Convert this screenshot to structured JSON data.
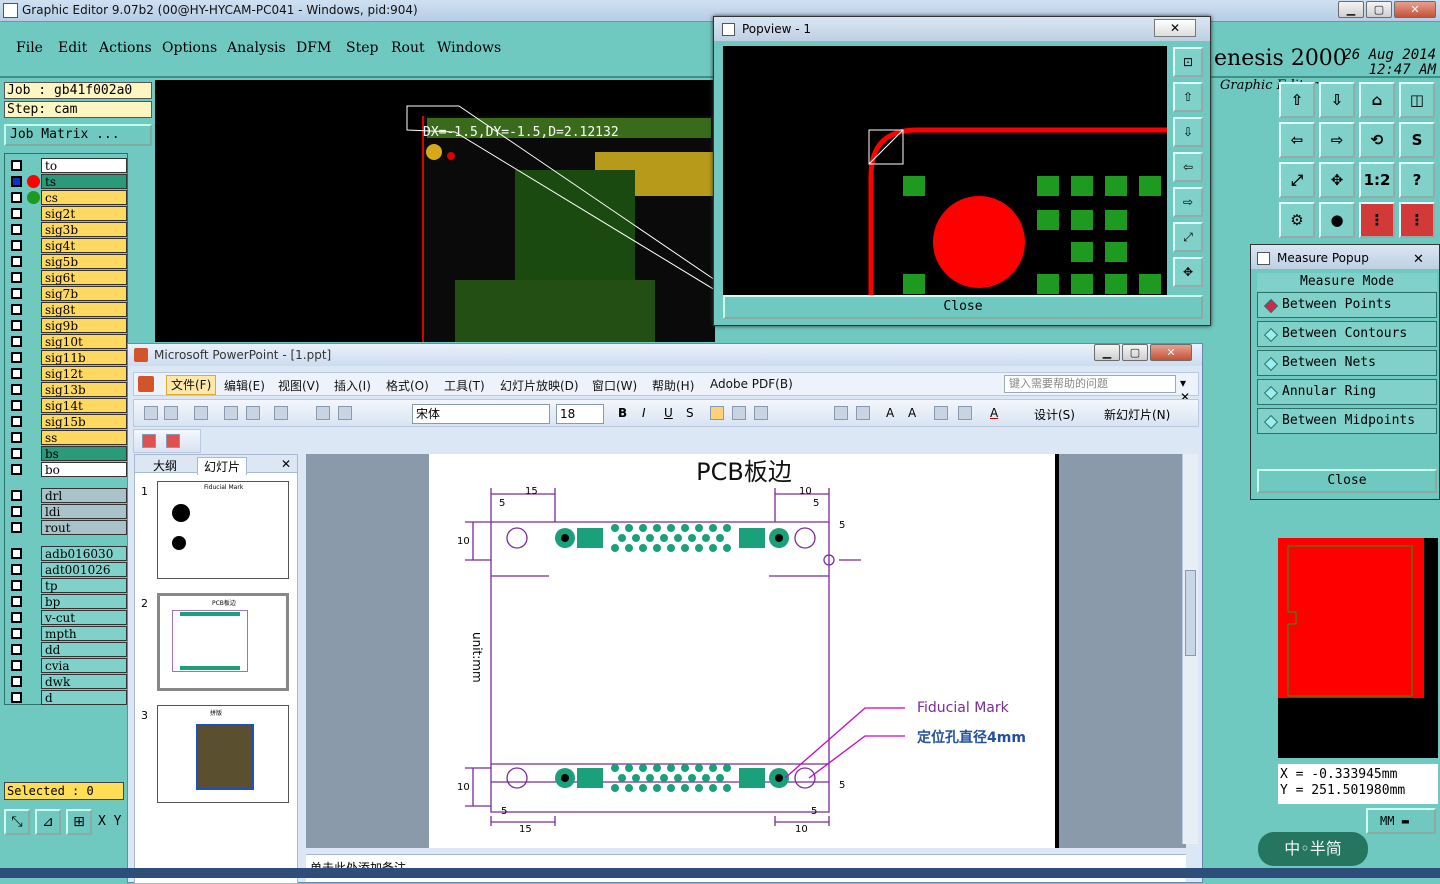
{
  "window": {
    "title": "Graphic Editor 9.07b2 (00@HY-HYCAM-PC041 - Windows, pid:904)"
  },
  "menu": [
    {
      "label": "File"
    },
    {
      "label": "Edit"
    },
    {
      "label": "Actions"
    },
    {
      "label": "Options"
    },
    {
      "label": "Analysis"
    },
    {
      "label": "DFM"
    },
    {
      "label": "Step"
    },
    {
      "label": "Rout"
    },
    {
      "label": "Windows"
    }
  ],
  "brand": {
    "name": "enesis 2000",
    "subtitle": "Graphic Editor",
    "date": "26 Aug 2014",
    "time": "12:47 AM"
  },
  "job": {
    "job_label": "Job : gb41f002a0",
    "step_label": "Step: cam",
    "matrix_button": "Job Matrix ..."
  },
  "layers": [
    {
      "name": "to",
      "color": "#ffffff"
    },
    {
      "name": "ts",
      "color": "#2a9a78",
      "dot": "#ff0000",
      "selected": true
    },
    {
      "name": "cs",
      "color": "#ffd860",
      "dot": "#1f9a20"
    },
    {
      "name": "sig2t",
      "color": "#ffd860"
    },
    {
      "name": "sig3b",
      "color": "#ffd860"
    },
    {
      "name": "sig4t",
      "color": "#ffd860"
    },
    {
      "name": "sig5b",
      "color": "#ffd860"
    },
    {
      "name": "sig6t",
      "color": "#ffd860"
    },
    {
      "name": "sig7b",
      "color": "#ffd860"
    },
    {
      "name": "sig8t",
      "color": "#ffd860"
    },
    {
      "name": "sig9b",
      "color": "#ffd860"
    },
    {
      "name": "sig10t",
      "color": "#ffd860"
    },
    {
      "name": "sig11b",
      "color": "#ffd860"
    },
    {
      "name": "sig12t",
      "color": "#ffd860"
    },
    {
      "name": "sig13b",
      "color": "#ffd860"
    },
    {
      "name": "sig14t",
      "color": "#ffd860"
    },
    {
      "name": "sig15b",
      "color": "#ffd860"
    },
    {
      "name": "ss",
      "color": "#ffd860"
    },
    {
      "name": "bs",
      "color": "#2a9a78"
    },
    {
      "name": "bo",
      "color": "#ffffff"
    }
  ],
  "drill_layers": [
    {
      "name": "drl"
    },
    {
      "name": "ldi"
    },
    {
      "name": "rout"
    }
  ],
  "misc_layers": [
    {
      "name": "adb016030"
    },
    {
      "name": "adt001026"
    },
    {
      "name": "tp"
    },
    {
      "name": "bp"
    },
    {
      "name": "v-cut"
    },
    {
      "name": "mpth"
    },
    {
      "name": "dd"
    },
    {
      "name": "cvia"
    },
    {
      "name": "dwk"
    },
    {
      "name": "d"
    }
  ],
  "selected_label": "Selected : 0",
  "xy_label": "X Y",
  "canvas": {
    "readout": "DX=-1.5,DY=-1.5,D=2.12132"
  },
  "popview": {
    "title": "Popview - 1",
    "close": "Close"
  },
  "measure": {
    "title": "Measure Popup",
    "header": "Measure Mode",
    "options": [
      {
        "label": "Between Points",
        "active": true
      },
      {
        "label": "Between Contours"
      },
      {
        "label": "Between Nets"
      },
      {
        "label": "Annular Ring"
      },
      {
        "label": "Between Midpoints"
      }
    ],
    "close": "Close"
  },
  "coords": {
    "x": "X = -0.333945mm",
    "y": "Y = 251.501980mm",
    "units": "MM"
  },
  "ppt": {
    "title": "Microsoft PowerPoint - [1.ppt]",
    "menu": [
      "文件(F)",
      "编辑(E)",
      "视图(V)",
      "插入(I)",
      "格式(O)",
      "工具(T)",
      "幻灯片放映(D)",
      "窗口(W)",
      "帮助(H)",
      "Adobe PDF(B)"
    ],
    "help_placeholder": "键入需要帮助的问题",
    "font": "宋体",
    "font_size": "18",
    "design": "设计(S)",
    "new_slide": "新幻灯片(N)",
    "tab_outline": "大纲",
    "tab_slides": "幻灯片",
    "thumbs": [
      {
        "num": "1",
        "caption": "Fiducial Mark"
      },
      {
        "num": "2",
        "caption": "PCB板边"
      },
      {
        "num": "3",
        "caption": "拼版"
      }
    ],
    "slide": {
      "title": "PCB板边",
      "dims": [
        "15",
        "5",
        "10",
        "10",
        "5",
        "5",
        "10",
        "5",
        "5",
        "15",
        "10",
        "5"
      ],
      "unit_label": "unit:mm",
      "callout1": "Fiducial  Mark",
      "callout2": "定位孔直径4mm"
    },
    "notes": "单击此处添加备注"
  },
  "watermark": "中◦半简",
  "colors": {
    "teal": "#6fc9c0",
    "pcb_red": "#ff0000",
    "pad_green": "#1f9a20",
    "callout": "#cc00cc",
    "line_purple": "#7a2a9a"
  }
}
